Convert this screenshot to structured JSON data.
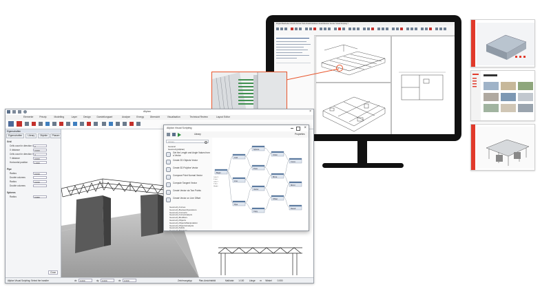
{
  "monitor": {
    "menu_items": [
      "Projekt",
      "Bearbeiten",
      "Ansicht",
      "Format",
      "Tools",
      "Zusatzfunktionen",
      "Ansichtfenster",
      "Fenster",
      "Visual Scripting",
      "?"
    ]
  },
  "app": {
    "title": "Allplan",
    "ribbon_tabs": [
      "Elemente",
      "Prinzip",
      "Modelling",
      "Layer",
      "Design",
      "Darstellungsart",
      "Analyse",
      "Energy",
      "Übersicht",
      "Visualisation",
      "Technical Review",
      "Layout Editor"
    ],
    "side_panel": {
      "header": "Eigenschaften",
      "tabs": [
        "Eigenschaften",
        "Library",
        "Objekte",
        "Phasen",
        "Layers"
      ],
      "sections": [
        {
          "title": "Grid",
          "rows": [
            {
              "label": "Cells count in direction X",
              "value": "2"
            },
            {
              "label": "X distance",
              "value": "3.000"
            },
            {
              "label": "Cells count in direction Y",
              "value": "4"
            },
            {
              "label": "Y distance",
              "value": "3.000"
            },
            {
              "label": "Horizontal position",
              "value": "1.000"
            }
          ]
        },
        {
          "title": "Pipe",
          "rows": [
            {
              "label": "Radius",
              "value": "0.030"
            },
            {
              "label": "Double columns",
              "value": ""
            },
            {
              "label": "Radius",
              "value": "0.030"
            },
            {
              "label": "Double columns",
              "value": ""
            }
          ]
        },
        {
          "title": "Spheres",
          "rows": [
            {
              "label": "Radius",
              "value": "0.080"
            }
          ]
        }
      ],
      "close_label": "Close"
    },
    "statusbar": {
      "prompt": "Allplan Visual Scripting: Select the handler",
      "fields": [
        {
          "label": "dx",
          "value": "0.000"
        },
        {
          "label": "dy",
          "value": "0.000"
        },
        {
          "label": "dz",
          "value": "0.000"
        }
      ],
      "status_items": [
        "Zeichnungstyp",
        "Plan-Ansichtsbild",
        "Maßstab",
        "1:100",
        "Länge",
        "m",
        "Winkel",
        "0.000"
      ]
    }
  },
  "visual_scripting": {
    "title": "Allplan Visual Scripting",
    "tool_labels": [
      "Library",
      "Properties"
    ],
    "search_placeholder": "Library",
    "tree_root": "General",
    "tree_group": "Geometry(Allplan)",
    "library_items": [
      "Get the Length and Angle Values from a Vector",
      "Create 2D Objects Vector",
      "Create 3D Polyline Vector",
      "Compose Point Normal Vector",
      "Compute Tangent Vector",
      "Create Vector via Two Points",
      "Create Vector on Line Offset"
    ],
    "library_list": [
      "Geometry.Curves",
      "Geometry.BooleanOperations",
      "Geometry.Converts",
      "Geometry.CurveAnalysis",
      "Geometry.Modifiers",
      "Geometry.Objects",
      "Geometry.ObjectsManipulation",
      "Geometry.ObjectsAnalysis",
      "Geometry.Solids",
      "Geometry.Polylines",
      "Geometry.Transformations"
    ],
    "node_labels": [
      "Begin",
      "Grid",
      "Line",
      "Pipe",
      "Sphere",
      "Point",
      "Vector",
      "Copy",
      "Union",
      "Move",
      "Offset",
      "Curve",
      "Mirror",
      "Result"
    ],
    "port_labels": [
      "Cells X",
      "X dist",
      "Cells Y",
      "Y dist",
      "Height"
    ]
  },
  "colors": {
    "accent": "#e13a2b",
    "callout": "#e8542a",
    "monitor": "#111111",
    "ribbon_active": "#c4302b"
  },
  "icons": [
    "monitor-icon",
    "save-icon",
    "undo-icon",
    "redo-icon",
    "gear-icon",
    "close-icon",
    "search-icon",
    "play-icon"
  ]
}
